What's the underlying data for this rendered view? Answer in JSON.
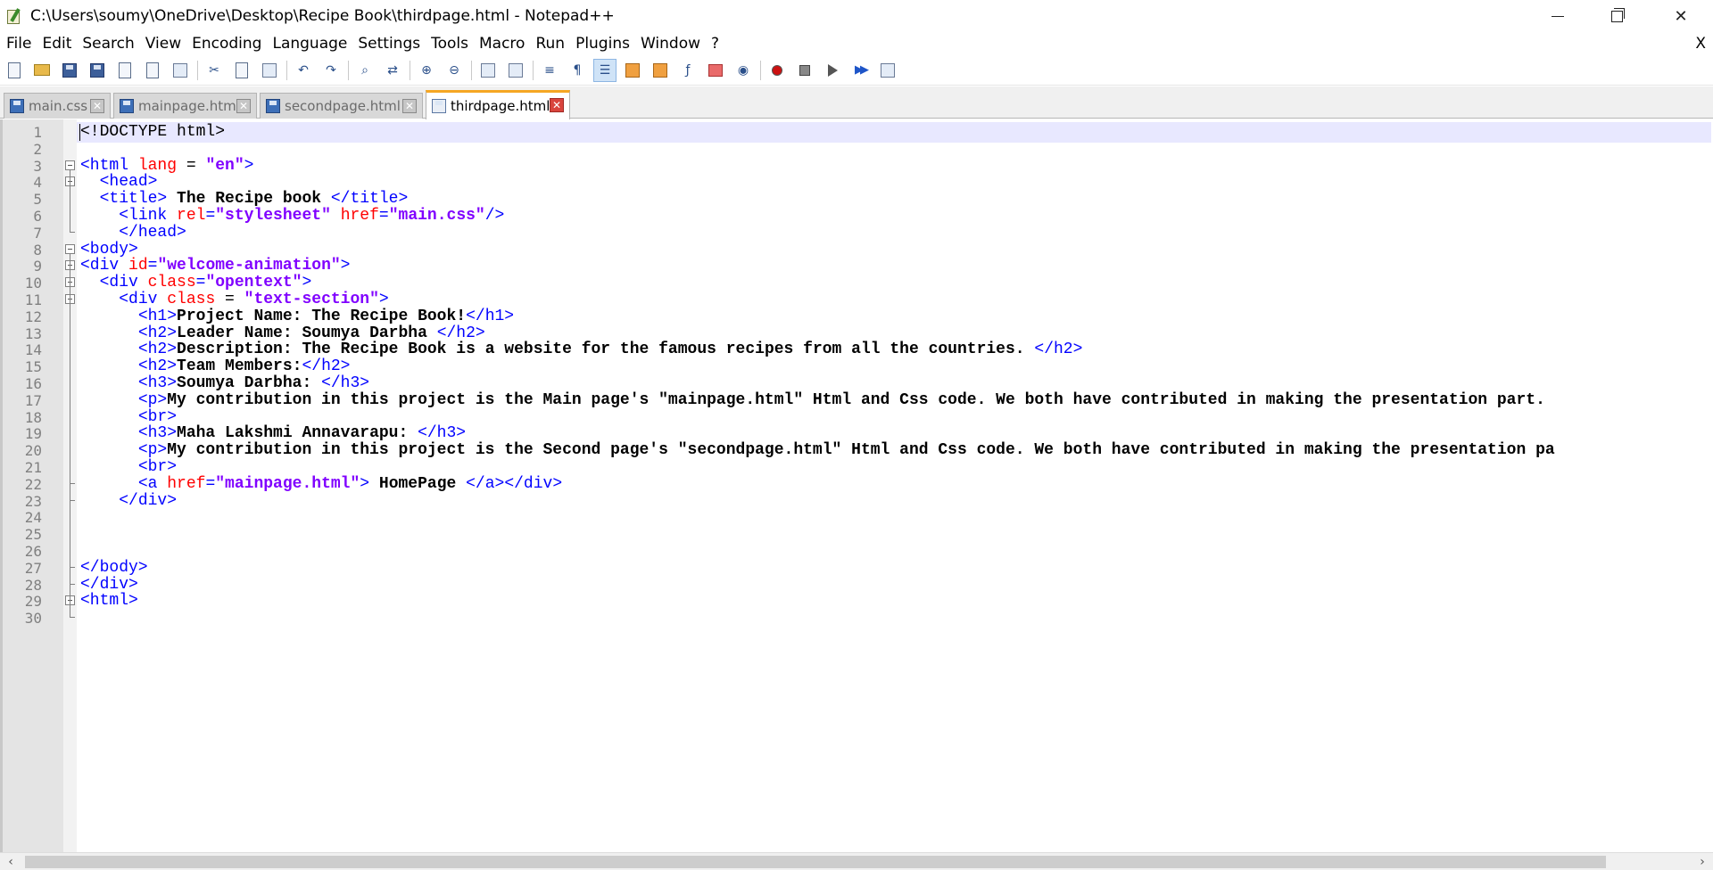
{
  "window": {
    "title": "C:\\Users\\soumy\\OneDrive\\Desktop\\Recipe Book\\thirdpage.html - Notepad++",
    "controls": {
      "minimize": "minimize",
      "maximize": "restore",
      "close": "✕"
    }
  },
  "menu": {
    "items": [
      "File",
      "Edit",
      "Search",
      "View",
      "Encoding",
      "Language",
      "Settings",
      "Tools",
      "Macro",
      "Run",
      "Plugins",
      "Window",
      "?"
    ],
    "close_label": "X"
  },
  "toolbar": {
    "icons": [
      "new-file-icon",
      "open-folder-icon",
      "save-icon",
      "save-all-icon",
      "close-icon",
      "close-all-icon",
      "print-icon",
      "cut-icon",
      "copy-icon",
      "paste-icon",
      "undo-icon",
      "redo-icon",
      "find-icon",
      "replace-icon",
      "zoom-in-icon",
      "zoom-out-icon",
      "sync-vertical-icon",
      "sync-horizontal-icon",
      "word-wrap-icon",
      "show-all-chars-icon",
      "indent-guide-icon",
      "user-lang-icon",
      "doc-map-icon",
      "function-list-icon",
      "folder-workspace-icon",
      "monitor-icon",
      "record-macro-icon",
      "stop-record-icon",
      "play-macro-icon",
      "run-macro-multiple-icon",
      "save-macro-icon"
    ]
  },
  "tabs": [
    {
      "label": "main.css",
      "active": false
    },
    {
      "label": "mainpage.html",
      "active": false
    },
    {
      "label": "secondpage.html",
      "active": false
    },
    {
      "label": "thirdpage.html",
      "active": true
    }
  ],
  "editor": {
    "current_line": 1,
    "lines": [
      [
        {
          "c": "doc",
          "t": "<!DOCTYPE html>"
        }
      ],
      [],
      [
        {
          "c": "tag",
          "t": "<html "
        },
        {
          "c": "attr",
          "t": "lang"
        },
        {
          "c": "doc",
          "t": " = "
        },
        {
          "c": "val",
          "t": "\"en\""
        },
        {
          "c": "tag",
          "t": ">"
        }
      ],
      [
        {
          "c": "doc",
          "t": "  "
        },
        {
          "c": "tag",
          "t": "<head>"
        }
      ],
      [
        {
          "c": "doc",
          "t": "  "
        },
        {
          "c": "tag",
          "t": "<title>"
        },
        {
          "c": "txt",
          "t": " The Recipe book "
        },
        {
          "c": "tag",
          "t": "</title>"
        }
      ],
      [
        {
          "c": "doc",
          "t": "    "
        },
        {
          "c": "tag",
          "t": "<link "
        },
        {
          "c": "attr",
          "t": "rel"
        },
        {
          "c": "tag",
          "t": "="
        },
        {
          "c": "val",
          "t": "\"stylesheet\""
        },
        {
          "c": "doc",
          "t": " "
        },
        {
          "c": "attr",
          "t": "href"
        },
        {
          "c": "tag",
          "t": "="
        },
        {
          "c": "val",
          "t": "\"main.css\""
        },
        {
          "c": "tag",
          "t": "/>"
        }
      ],
      [
        {
          "c": "doc",
          "t": "    "
        },
        {
          "c": "tag",
          "t": "</head>"
        }
      ],
      [
        {
          "c": "tag",
          "t": "<body>"
        }
      ],
      [
        {
          "c": "tag",
          "t": "<div "
        },
        {
          "c": "attr",
          "t": "id"
        },
        {
          "c": "tag",
          "t": "="
        },
        {
          "c": "val",
          "t": "\"welcome-animation\""
        },
        {
          "c": "tag",
          "t": ">"
        }
      ],
      [
        {
          "c": "doc",
          "t": "  "
        },
        {
          "c": "tag",
          "t": "<div "
        },
        {
          "c": "attr",
          "t": "class"
        },
        {
          "c": "tag",
          "t": "="
        },
        {
          "c": "val",
          "t": "\"opentext\""
        },
        {
          "c": "tag",
          "t": ">"
        }
      ],
      [
        {
          "c": "doc",
          "t": "    "
        },
        {
          "c": "tag",
          "t": "<div "
        },
        {
          "c": "attr",
          "t": "class"
        },
        {
          "c": "doc",
          "t": " = "
        },
        {
          "c": "val",
          "t": "\"text-section\""
        },
        {
          "c": "tag",
          "t": ">"
        }
      ],
      [
        {
          "c": "doc",
          "t": "      "
        },
        {
          "c": "tag",
          "t": "<h1>"
        },
        {
          "c": "txt",
          "t": "Project Name: The Recipe Book!"
        },
        {
          "c": "tag",
          "t": "</h1>"
        }
      ],
      [
        {
          "c": "doc",
          "t": "      "
        },
        {
          "c": "tag",
          "t": "<h2>"
        },
        {
          "c": "txt",
          "t": "Leader Name: Soumya Darbha "
        },
        {
          "c": "tag",
          "t": "</h2>"
        }
      ],
      [
        {
          "c": "doc",
          "t": "      "
        },
        {
          "c": "tag",
          "t": "<h2>"
        },
        {
          "c": "txt",
          "t": "Description: The Recipe Book is a website for the famous recipes from all the countries. "
        },
        {
          "c": "tag",
          "t": "</h2>"
        }
      ],
      [
        {
          "c": "doc",
          "t": "      "
        },
        {
          "c": "tag",
          "t": "<h2>"
        },
        {
          "c": "txt",
          "t": "Team Members:"
        },
        {
          "c": "tag",
          "t": "</h2>"
        }
      ],
      [
        {
          "c": "doc",
          "t": "      "
        },
        {
          "c": "tag",
          "t": "<h3>"
        },
        {
          "c": "txt",
          "t": "Soumya Darbha: "
        },
        {
          "c": "tag",
          "t": "</h3>"
        }
      ],
      [
        {
          "c": "doc",
          "t": "      "
        },
        {
          "c": "tag",
          "t": "<p>"
        },
        {
          "c": "txt",
          "t": "My contribution in this project is the Main page's \"mainpage.html\" Html and Css code. We both have contributed in making the presentation part."
        }
      ],
      [
        {
          "c": "doc",
          "t": "      "
        },
        {
          "c": "tag",
          "t": "<br>"
        }
      ],
      [
        {
          "c": "doc",
          "t": "      "
        },
        {
          "c": "tag",
          "t": "<h3>"
        },
        {
          "c": "txt",
          "t": "Maha Lakshmi Annavarapu: "
        },
        {
          "c": "tag",
          "t": "</h3>"
        }
      ],
      [
        {
          "c": "doc",
          "t": "      "
        },
        {
          "c": "tag",
          "t": "<p>"
        },
        {
          "c": "txt",
          "t": "My contribution in this project is the Second page's \"secondpage.html\" Html and Css code. We both have contributed in making the presentation pa"
        }
      ],
      [
        {
          "c": "doc",
          "t": "      "
        },
        {
          "c": "tag",
          "t": "<br>"
        }
      ],
      [
        {
          "c": "doc",
          "t": "      "
        },
        {
          "c": "tag",
          "t": "<a "
        },
        {
          "c": "attr",
          "t": "href"
        },
        {
          "c": "tag",
          "t": "="
        },
        {
          "c": "val",
          "t": "\"mainpage.html\""
        },
        {
          "c": "tag",
          "t": ">"
        },
        {
          "c": "txt",
          "t": " HomePage "
        },
        {
          "c": "tag",
          "t": "</a></div>"
        }
      ],
      [
        {
          "c": "doc",
          "t": "    "
        },
        {
          "c": "tag",
          "t": "</div>"
        }
      ],
      [],
      [],
      [],
      [
        {
          "c": "tag",
          "t": "</body>"
        }
      ],
      [
        {
          "c": "tag",
          "t": "</div>"
        }
      ],
      [
        {
          "c": "tag",
          "t": "<html>"
        }
      ],
      []
    ]
  }
}
